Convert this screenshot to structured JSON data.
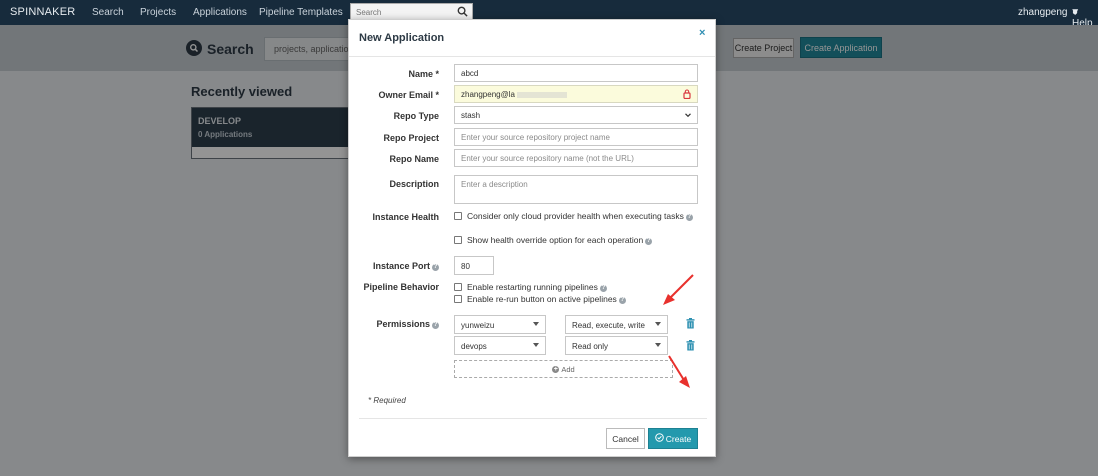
{
  "navbar": {
    "brand": "SPINNAKER",
    "links": [
      "Search",
      "Projects",
      "Applications",
      "Pipeline Templates"
    ],
    "search_placeholder": "Search",
    "user": "zhangpeng",
    "help": "Help"
  },
  "background": {
    "search_title": "Search",
    "search_input_value": "projects, application",
    "create_project_label": "Create Project",
    "create_application_label": "Create Application",
    "recent_title": "Recently viewed",
    "project_card": {
      "name": "DEVELOP",
      "count": "0 Applications"
    }
  },
  "modal": {
    "title": "New Application",
    "close_glyph": "×",
    "fields": {
      "name": {
        "label": "Name *",
        "value": "abcd"
      },
      "owner_email": {
        "label": "Owner Email *",
        "value": "zhangpeng@la"
      },
      "repo_type": {
        "label": "Repo Type",
        "value": "stash"
      },
      "repo_project": {
        "label": "Repo Project",
        "placeholder": "Enter your source repository project name"
      },
      "repo_name": {
        "label": "Repo Name",
        "placeholder": "Enter your source repository name (not the URL)"
      },
      "description": {
        "label": "Description",
        "placeholder": "Enter a description"
      }
    },
    "instance_health": {
      "label": "Instance Health",
      "option1": "Consider only cloud provider health when executing tasks",
      "option2": "Show health override option for each operation"
    },
    "instance_port": {
      "label": "Instance Port",
      "value": "80"
    },
    "pipeline_behavior": {
      "label": "Pipeline Behavior",
      "option1": "Enable restarting running pipelines",
      "option2": "Enable re-run button on active pipelines"
    },
    "permissions": {
      "label": "Permissions",
      "rows": [
        {
          "group": "yunweizu",
          "access": "Read, execute, write"
        },
        {
          "group": "devops",
          "access": "Read only"
        }
      ],
      "add_label": "Add"
    },
    "required_note": "* Required",
    "cancel_label": "Cancel",
    "create_label": "Create"
  },
  "colors": {
    "navbar_bg": "#172b3c",
    "primary": "#2399ad",
    "annotation_arrow": "#e8312d"
  }
}
